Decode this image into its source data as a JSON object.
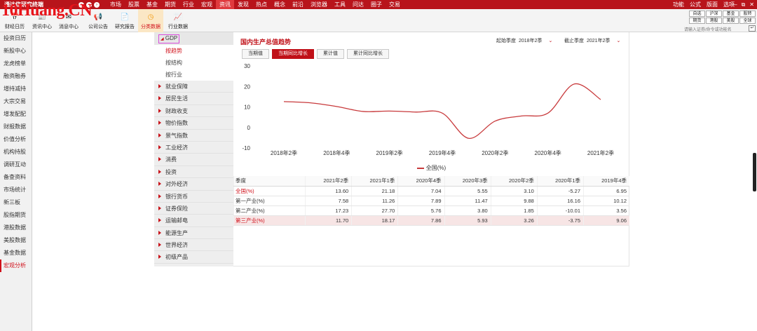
{
  "app": {
    "title": "通达信研究终端",
    "watermark": "10Huang.CN"
  },
  "topmenu": {
    "items": [
      "市场",
      "股票",
      "基金",
      "期货",
      "行业",
      "宏观",
      "资讯",
      "发现",
      "热点",
      "概念",
      "前沿",
      "浏览器",
      "工具",
      "问达",
      "圈子",
      "交易"
    ],
    "active_index": 6,
    "right": [
      "功能",
      "公式",
      "版面",
      "选项"
    ],
    "window_controls": [
      "—",
      "⧉",
      "✕"
    ]
  },
  "toolbar": {
    "items": [
      {
        "label": "财经日历"
      },
      {
        "label": "资讯中心"
      },
      {
        "label": "消息中心"
      },
      {
        "label": "公司公告"
      },
      {
        "label": "研究报告"
      },
      {
        "label": "分类数据"
      },
      {
        "label": "行业数据"
      }
    ],
    "active_index": 5,
    "quick": [
      "自选",
      "沪深",
      "基金",
      "股转",
      "期货",
      "港股",
      "美股",
      "全球"
    ],
    "search_placeholder": "请输入证券/命令或功能名"
  },
  "leftnav": {
    "items": [
      "投资日历",
      "新股中心",
      "龙虎榜单",
      "融资融券",
      "增持减持",
      "大宗交易",
      "增发配配",
      "财报数据",
      "价值分析",
      "机构持股",
      "调研互动",
      "备查资料",
      "市场统计",
      "新三板",
      "股指期货",
      "港股数据",
      "美股数据",
      "基金数据",
      "宏观分析"
    ],
    "active_index": 18
  },
  "category": {
    "head": "GDP",
    "subs": [
      "按趋势",
      "按结构",
      "按行业"
    ],
    "active_sub": 0,
    "items": [
      "就业保障",
      "居民生活",
      "财政收支",
      "物价指数",
      "景气指数",
      "工业经济",
      "消费",
      "投资",
      "对外经济",
      "银行货币",
      "证券保险",
      "运输邮电",
      "能源生产",
      "世界经济",
      "初级产品"
    ]
  },
  "main": {
    "title": "国内生产总值趋势",
    "start_label": "起始季度",
    "start_value": "2018年2季",
    "end_label": "截止季度",
    "end_value": "2021年2季",
    "tabs": [
      "当期值",
      "当期同比增长",
      "累计值",
      "累计同比增长"
    ],
    "active_tab": 1
  },
  "chart_data": {
    "type": "line",
    "x_ticks": [
      "2018年2季",
      "2018年4季",
      "2019年2季",
      "2019年4季",
      "2020年2季",
      "2020年4季",
      "2021年2季"
    ],
    "y_ticks": [
      30,
      20,
      10,
      0,
      -10
    ],
    "ylim": [
      -10,
      30
    ],
    "x": [
      "2018年2季",
      "2018年3季",
      "2018年4季",
      "2019年1季",
      "2019年2季",
      "2019年3季",
      "2019年4季",
      "2020年1季",
      "2020年2季",
      "2020年3季",
      "2020年4季",
      "2021年1季",
      "2021年2季"
    ],
    "series": [
      {
        "name": "全国(%)",
        "color": "#c83a3c",
        "values": [
          12.6,
          12.0,
          10.2,
          7.8,
          8.0,
          7.5,
          7.0,
          -5.3,
          3.1,
          5.6,
          7.0,
          21.2,
          13.6
        ]
      }
    ],
    "grid": false,
    "legend": "bottom-center"
  },
  "table": {
    "headers": [
      "季度",
      "2021年2季",
      "2021年1季",
      "2020年4季",
      "2020年3季",
      "2020年2季",
      "2020年1季",
      "2019年4季"
    ],
    "rows": [
      {
        "label": "全国(%)",
        "values": [
          "13.60",
          "21.18",
          "7.04",
          "5.55",
          "3.10",
          "-5.27",
          "6.95"
        ]
      },
      {
        "label": "第一产业(%)",
        "values": [
          "7.58",
          "11.26",
          "7.89",
          "11.47",
          "9.88",
          "16.16",
          "10.12"
        ]
      },
      {
        "label": "第二产业(%)",
        "values": [
          "17.23",
          "27.70",
          "5.76",
          "3.80",
          "1.85",
          "-10.01",
          "3.56"
        ]
      },
      {
        "label": "第三产业(%)",
        "values": [
          "11.70",
          "18.17",
          "7.86",
          "5.93",
          "3.26",
          "-3.75",
          "9.06"
        ]
      }
    ]
  }
}
